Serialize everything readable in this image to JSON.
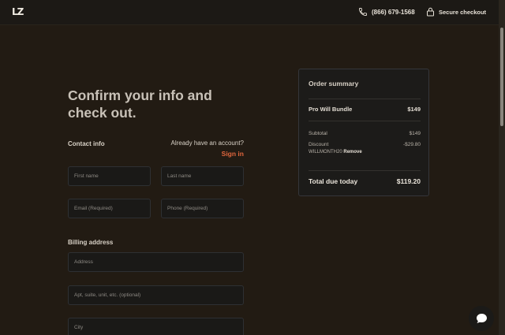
{
  "header": {
    "logo": "LZ",
    "phone": "(866) 679-1568",
    "secure": "Secure checkout"
  },
  "form": {
    "heading": "Confirm your info and check out.",
    "contact_label": "Contact info",
    "already_account": "Already have an account?",
    "sign_in": "Sign in",
    "first_name": "First name",
    "last_name": "Last name",
    "email": "Email (Required)",
    "phone": "Phone (Required)",
    "billing_label": "Billing address",
    "address": "Address",
    "apt": "Apt, suite, unit, etc. (optional)",
    "city": "City"
  },
  "summary": {
    "title": "Order summary",
    "item_name": "Pro Will Bundle",
    "item_price": "$149",
    "subtotal_label": "Subtotal",
    "subtotal_value": "$149",
    "discount_label": "Discount",
    "discount_value": "-$29.80",
    "discount_code": "WILLMONTH20",
    "remove": "Remove",
    "total_label": "Total due today",
    "total_value": "$119.20"
  }
}
